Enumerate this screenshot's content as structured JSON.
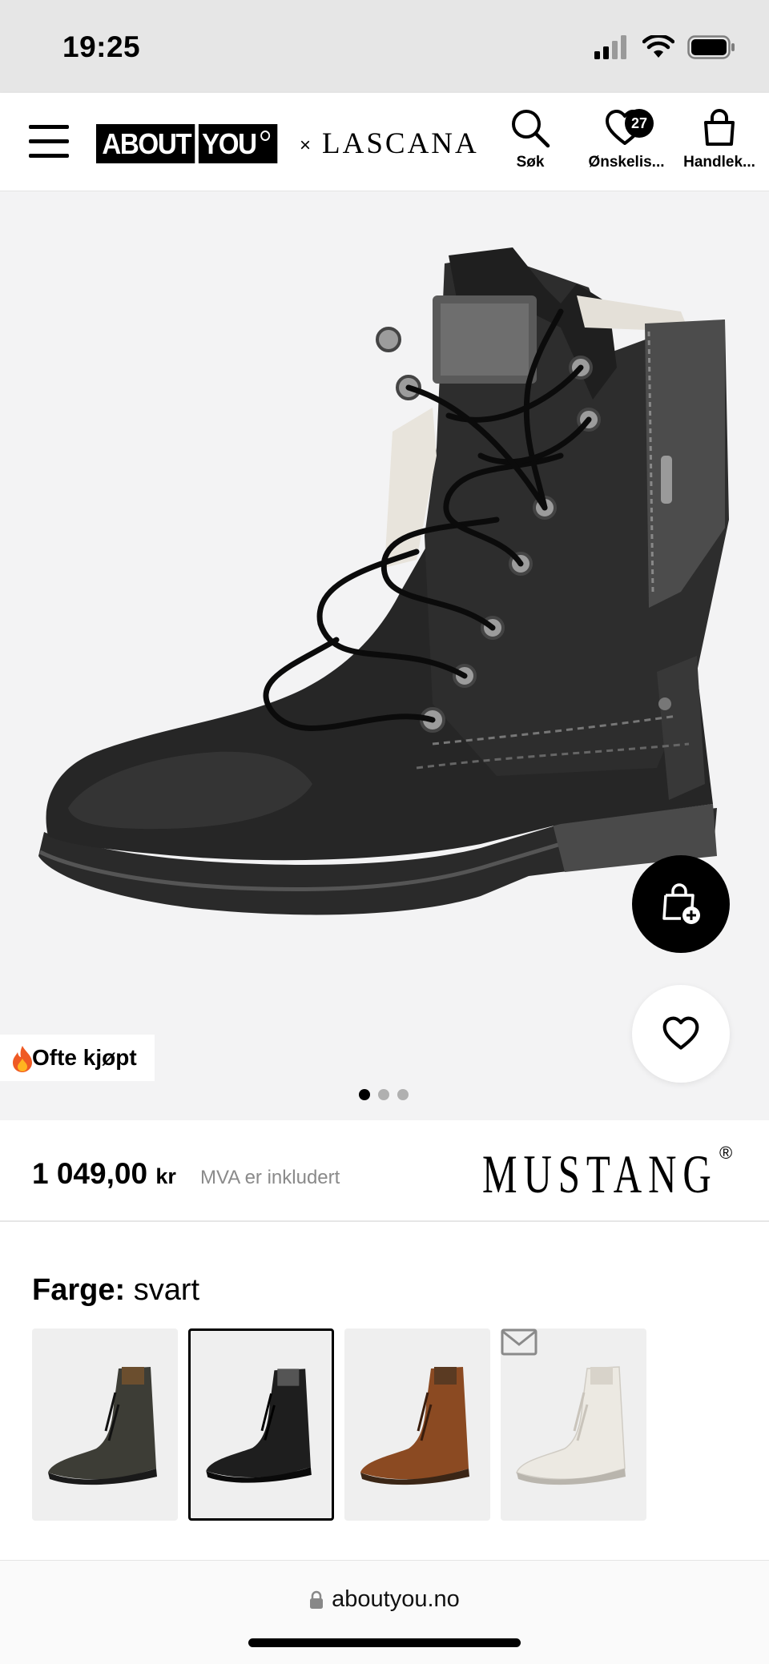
{
  "status_bar": {
    "time": "19:25"
  },
  "header": {
    "logo_primary": [
      "ABOUT",
      "YOU"
    ],
    "logo_x": "×",
    "logo_partner": "LASCANA",
    "search_label": "Søk",
    "wishlist_label": "Ønskelis...",
    "wishlist_count": "27",
    "cart_label": "Handlek..."
  },
  "hero": {
    "badge_label": "Ofte kjøpt",
    "image_count": 3,
    "active_image": 1
  },
  "price": {
    "amount": "1 049,00",
    "currency": "kr",
    "vat_note": "MVA er inkludert",
    "brand": "MUSTANG",
    "brand_mark": "®"
  },
  "color": {
    "label": "Farge:",
    "value": "svart",
    "options": [
      {
        "name": "dark grey",
        "hex": "#3d3d36"
      },
      {
        "name": "svart",
        "hex": "#1e1e1e",
        "selected": true
      },
      {
        "name": "brown",
        "hex": "#8b4a22"
      },
      {
        "name": "white",
        "hex": "#ece9e2"
      }
    ]
  },
  "browser": {
    "url": "aboutyou.no"
  },
  "colors": {
    "accent": "#000000",
    "background": "#f3f3f4",
    "muted": "#8a8a8a"
  }
}
